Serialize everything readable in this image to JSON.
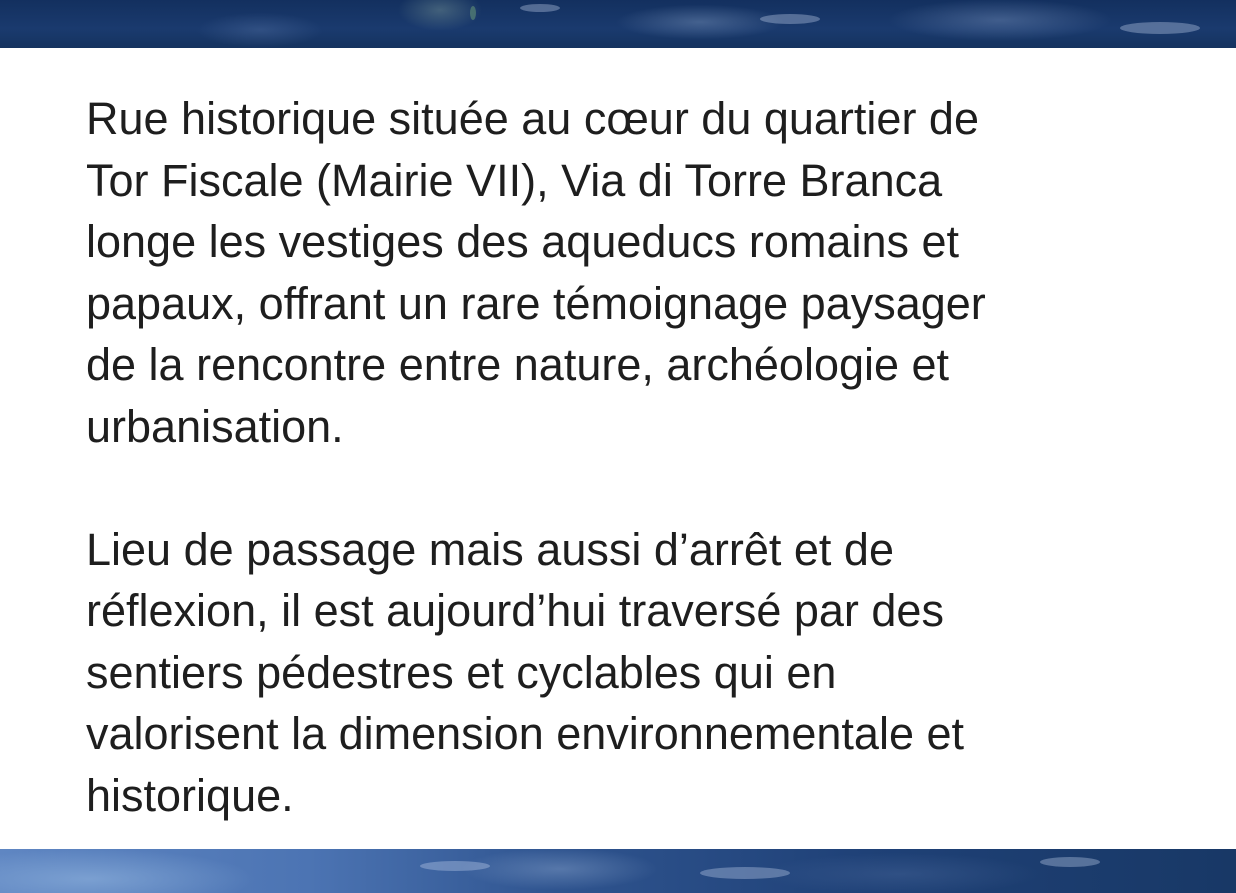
{
  "paragraphs": [
    "Rue historique située au cœur du quartier de\nTor Fiscale (Mairie VII), Via di Torre Branca\nlonge les vestiges des aqueducs romains et\npapaux, offrant un rare témoignage paysager\nde la rencontre entre nature, archéologie et\nurbanisation.",
    "Lieu de passage mais aussi d’arrêt et de\nréflexion, il est aujourd’hui traversé par des\nsentiers pédestres et cyclables qui en\nvalorisent la dimension environnementale et\nhistorique."
  ],
  "colors": {
    "text": "#1e1e1e",
    "banner_top": "#1a3a6e",
    "banner_bottom_light": "#5f86c2",
    "banner_bottom_dark": "#183866",
    "background": "#ffffff"
  }
}
